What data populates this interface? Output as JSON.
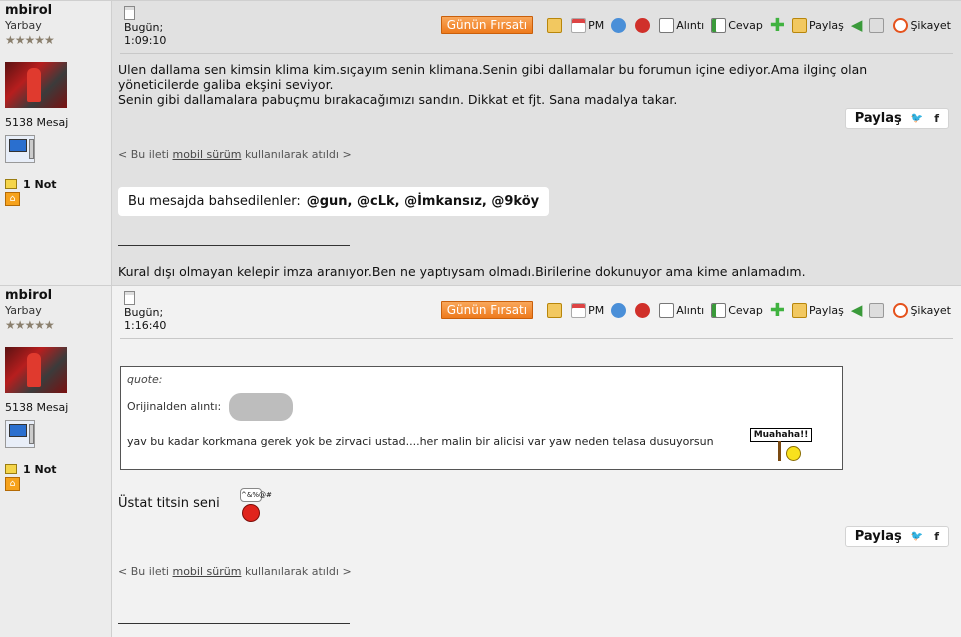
{
  "toolbar": {
    "deal_label": "Günün Fırsatı",
    "pm_label": "PM",
    "quote_label": "Alıntı",
    "reply_label": "Cevap",
    "share_label": "Paylaş",
    "complaint_label": "Şikayet"
  },
  "colors": {
    "deal_button": "#ee7a1c",
    "post1_bg": "#e1e1e1",
    "post2_bg": "#f2f2f2",
    "sidebar_bg": "#ececec"
  },
  "posts": [
    {
      "author": {
        "name": "mbirol",
        "rank": "Yarbay",
        "stars": "★★★★★",
        "message_count": "5138 Mesaj",
        "notes": "1 Not"
      },
      "date": "Bugün;",
      "time": "1:09:10",
      "body_lines": [
        "Ulen dallama sen kimsin klima kim.sıçayım senin klimana.Senin gibi dallamalar bu forumun içine ediyor.Ama ilginç olan",
        "yöneticilerde galiba ekşini seviyor.",
        "Senin gibi dallamalara pabuçmu bırakacağımızı sandın. Dikkat et fjt. Sana madalya takar."
      ],
      "share_label": "Paylaş",
      "mobile_prefix": "< Bu ileti",
      "mobile_link": "mobil sürüm",
      "mobile_suffix": "kullanılarak atıldı >",
      "mentions_label": "Bu mesajda bahsedilenler:",
      "mentions": "@gun, @cLk, @İmkansız, @9köy",
      "signature": "Kural dışı olmayan kelepir imza aranıyor.Ben ne yaptıysam olmadı.Birilerine dokunuyor ama kime anlamadım."
    },
    {
      "author": {
        "name": "mbirol",
        "rank": "Yarbay",
        "stars": "★★★★★",
        "message_count": "5138 Mesaj",
        "notes": "1 Not"
      },
      "date": "Bugün;",
      "time": "1:16:40",
      "quote_label": "quote:",
      "quote_source": "Orijinalden alıntı:",
      "quote_text": "yav bu kadar korkmana gerek yok be zirvaci ustad....her malin bir alicisi var yaw neden telasa dusuyorsun",
      "smiley_sign": "Muahaha!!",
      "angry_bubble": "^&%@#",
      "body": "Üstat titsin seni",
      "share_label": "Paylaş",
      "mobile_prefix": "< Bu ileti",
      "mobile_link": "mobil sürüm",
      "mobile_suffix": "kullanılarak atıldı >"
    }
  ]
}
